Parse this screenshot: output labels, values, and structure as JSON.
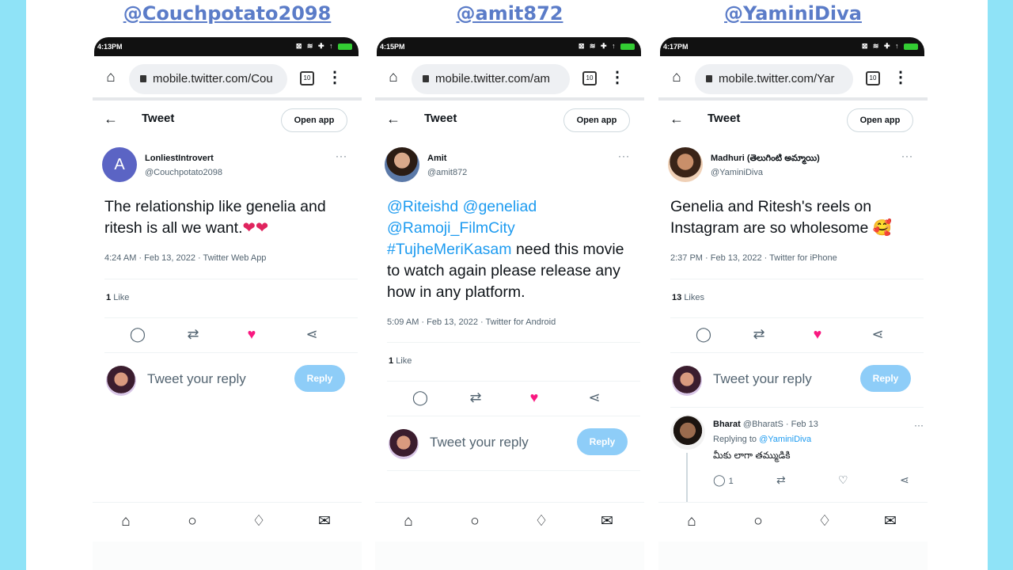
{
  "common": {
    "status_icons": "⊠ ≋ ✚ ↑",
    "tab_count": "10",
    "menu_glyph": "⋮",
    "back_glyph": "←",
    "tweet_title": "Tweet",
    "open_app": "Open app",
    "more_glyph": "···",
    "reply_placeholder": "Tweet your reply",
    "reply_button": "Reply",
    "icons": {
      "home": "home-icon",
      "search": "search-icon",
      "bell": "bell-icon",
      "mail": "mail-icon",
      "comment": "comment-icon",
      "retweet": "retweet-icon",
      "like": "heart-icon",
      "share": "share-icon"
    },
    "colors": {
      "background": "#8fe3f7",
      "handle": "#5b7cc8",
      "link": "#1d9bf0",
      "like": "#f91880",
      "reply_button": "#8ecdf8"
    }
  },
  "panels": [
    {
      "handle": "@Couchpotato2098",
      "time": "4:13PM",
      "url": "mobile.twitter.com/Cou",
      "author_name": "LonliestIntrovert",
      "author_handle": "@Couchpotato2098",
      "avatar_letter": "A",
      "text_plain": "The relationship like genelia and ritesh is all we want.",
      "text_emoji": "❤❤",
      "meta": "4:24 AM · Feb 13, 2022 · Twitter Web App",
      "likes_count": "1",
      "likes_label": "Like"
    },
    {
      "handle": "@amit872",
      "time": "4:15PM",
      "url": "mobile.twitter.com/am",
      "author_name": "Amit",
      "author_handle": "@amit872",
      "links": [
        "@Riteishd",
        "@geneliad",
        "@Ramoji_FilmCity",
        "#TujheMeriKasam"
      ],
      "text_plain": "need this movie to watch again please release any how in any platform.",
      "meta": "5:09 AM · Feb 13, 2022 · Twitter for Android",
      "likes_count": "1",
      "likes_label": "Like"
    },
    {
      "handle": "@YaminiDiva",
      "time": "4:17PM",
      "url": "mobile.twitter.com/Yar",
      "author_name": "Madhuri (తెలుగింటి అమ్మాయి)",
      "author_handle": "@YaminiDiva",
      "text_plain": "Genelia and Ritesh's reels on Instagram are so wholesome",
      "text_emoji": "🥰",
      "meta": "2:37 PM · Feb 13, 2022 · Twitter for iPhone",
      "likes_count": "13",
      "likes_label": "Likes",
      "comment": {
        "name": "Bharat",
        "handle_date": "@BharatS · Feb 13",
        "replying_prefix": "Replying to",
        "replying_to": "@YaminiDiva",
        "text": "మీకు లాగా తమ్ముడికి",
        "reply_count": "1"
      }
    }
  ]
}
